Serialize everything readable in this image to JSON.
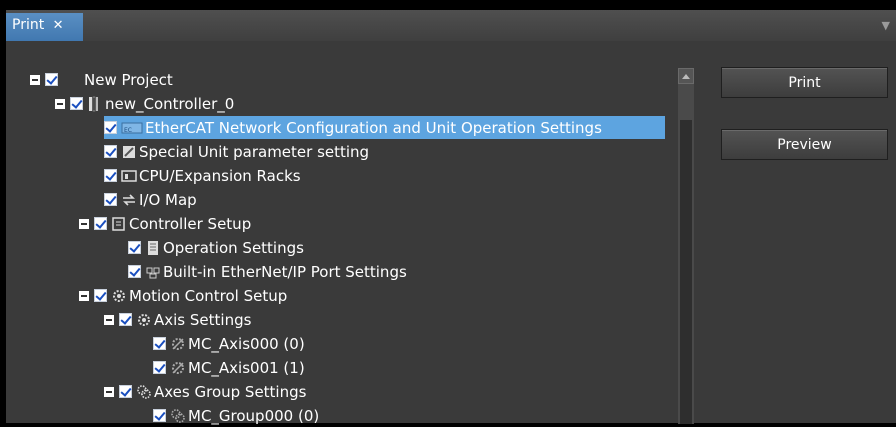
{
  "tab": {
    "title": "Print",
    "close_glyph": "✕"
  },
  "buttons": {
    "print": "Print",
    "preview": "Preview"
  },
  "tree": [
    {
      "label": "New Project",
      "icon": ""
    },
    {
      "label": "new_Controller_0",
      "icon": "controller-icon"
    },
    {
      "label": "EtherCAT Network Configuration and Unit Operation Settings",
      "icon": "ethercat-icon"
    },
    {
      "label": "Special Unit parameter setting",
      "icon": "parameter-icon"
    },
    {
      "label": "CPU/Expansion Racks",
      "icon": "cpu-rack-icon"
    },
    {
      "label": "I/O Map",
      "icon": "io-map-icon"
    },
    {
      "label": "Controller Setup",
      "icon": "controller-setup-icon"
    },
    {
      "label": "Operation Settings",
      "icon": "operation-settings-icon"
    },
    {
      "label": "Built-in EtherNet/IP Port Settings",
      "icon": "ethernet-port-icon"
    },
    {
      "label": "Motion Control Setup",
      "icon": "motion-gear-icon"
    },
    {
      "label": "Axis Settings",
      "icon": "axis-gear-icon"
    },
    {
      "label": "MC_Axis000 (0)",
      "icon": "axis-icon"
    },
    {
      "label": "MC_Axis001 (1)",
      "icon": "axis-icon"
    },
    {
      "label": "Axes Group Settings",
      "icon": "axes-group-icon"
    },
    {
      "label": "MC_Group000 (0)",
      "icon": "axes-group-item-icon"
    }
  ],
  "colors": {
    "selection": "#5da4e0",
    "tab": "#4a82bb",
    "panel": "#3a3a3a"
  }
}
